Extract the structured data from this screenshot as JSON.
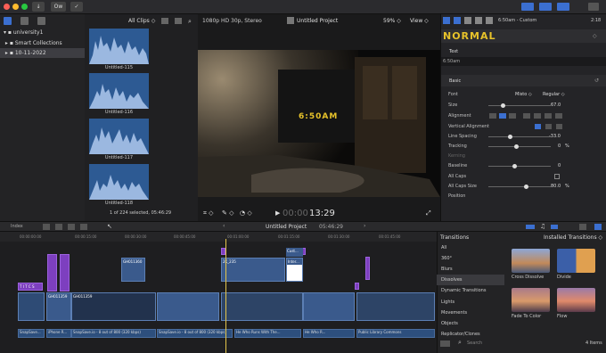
{
  "colors": {
    "accent": "#3b6fd0",
    "title_yellow": "#e7c22a",
    "purple": "#7d3fbf",
    "clip_blue": "#3a5a8c"
  },
  "topbar": {
    "library_button": "↓",
    "key_button": "Ow",
    "check_button": "✓"
  },
  "sidebar": {
    "items": [
      {
        "label": "university1",
        "icon": "library-icon"
      },
      {
        "label": "Smart Collections",
        "icon": "folder-icon"
      },
      {
        "label": "10-11-2022",
        "icon": "event-icon"
      }
    ]
  },
  "browser": {
    "filter": "All Clips",
    "clips": [
      "Untitled-115",
      "Untitled-116",
      "Untitled-117",
      "Untitled-118"
    ],
    "status": "1 of 224 selected, 05:46:29"
  },
  "viewer": {
    "format": "1080p HD 30p, Stereo",
    "project": "Untitled Project",
    "zoom": "59%",
    "view": "View",
    "overlay_text": "6:50AM",
    "timecode_dim": "00:00",
    "timecode": "13:29"
  },
  "inspector": {
    "clock": "2:18",
    "title_name": "6:50am - Custom",
    "style_name": "NORMAL",
    "text_section": "Text",
    "text_value": "6:50am",
    "basic": "Basic",
    "rows": [
      {
        "label": "Font",
        "value": "Misto"
      },
      {
        "label": "Size",
        "value": "67.0"
      },
      {
        "label": "Alignment",
        "value": ""
      },
      {
        "label": "Vertical Alignment",
        "value": ""
      },
      {
        "label": "Line Spacing",
        "value": "-33.0"
      },
      {
        "label": "Tracking",
        "value": "0"
      },
      {
        "label": "Kerning",
        "value": ""
      },
      {
        "label": "Baseline",
        "value": "0"
      },
      {
        "label": "All Caps",
        "value": ""
      },
      {
        "label": "All Caps Size",
        "value": "80.0"
      },
      {
        "label": "Position",
        "value": ""
      }
    ],
    "font_weight": "Regular",
    "percent_sign": "%"
  },
  "timeline_bar": {
    "index": "Index",
    "project": "Untitled Project",
    "duration": "05:46:29"
  },
  "ruler": [
    "00:00:00:00",
    "00:00:15:00",
    "00:00:30:00",
    "00:00:45:00",
    "00:01:00:00",
    "00:01:15:00",
    "00:01:30:00",
    "00:01:45:00"
  ],
  "clips": {
    "c1": "GH011360",
    "c2": "2K_235",
    "c3": "Inter...",
    "c4": "Cust...",
    "c5": "GH011359",
    "c6": "GH011359",
    "c7": "T I T C S"
  },
  "audio": {
    "a1": "SnapSave...",
    "a2": "iPhone R...",
    "a3": "SnapSave.io - 8 out of 800 (320 kbps)",
    "a4": "SnapSave.io - 8 out of 800 (320 kbps)",
    "a5": "He Who Runs With The...",
    "a6": "He Who R...",
    "a7": "Public Library Commons"
  },
  "transitions": {
    "header": "Transitions",
    "installed": "Installed Transitions",
    "categories": [
      "All",
      "360°",
      "Blurs",
      "Dissolves",
      "Dynamic Transitions",
      "Lights",
      "Movements",
      "Objects",
      "Replicator/Clones"
    ],
    "selected": "Dissolves",
    "items": [
      "Cross Dissolve",
      "Divide",
      "Fade To Color",
      "Flow"
    ],
    "search": "Search",
    "count": "4 Items"
  }
}
